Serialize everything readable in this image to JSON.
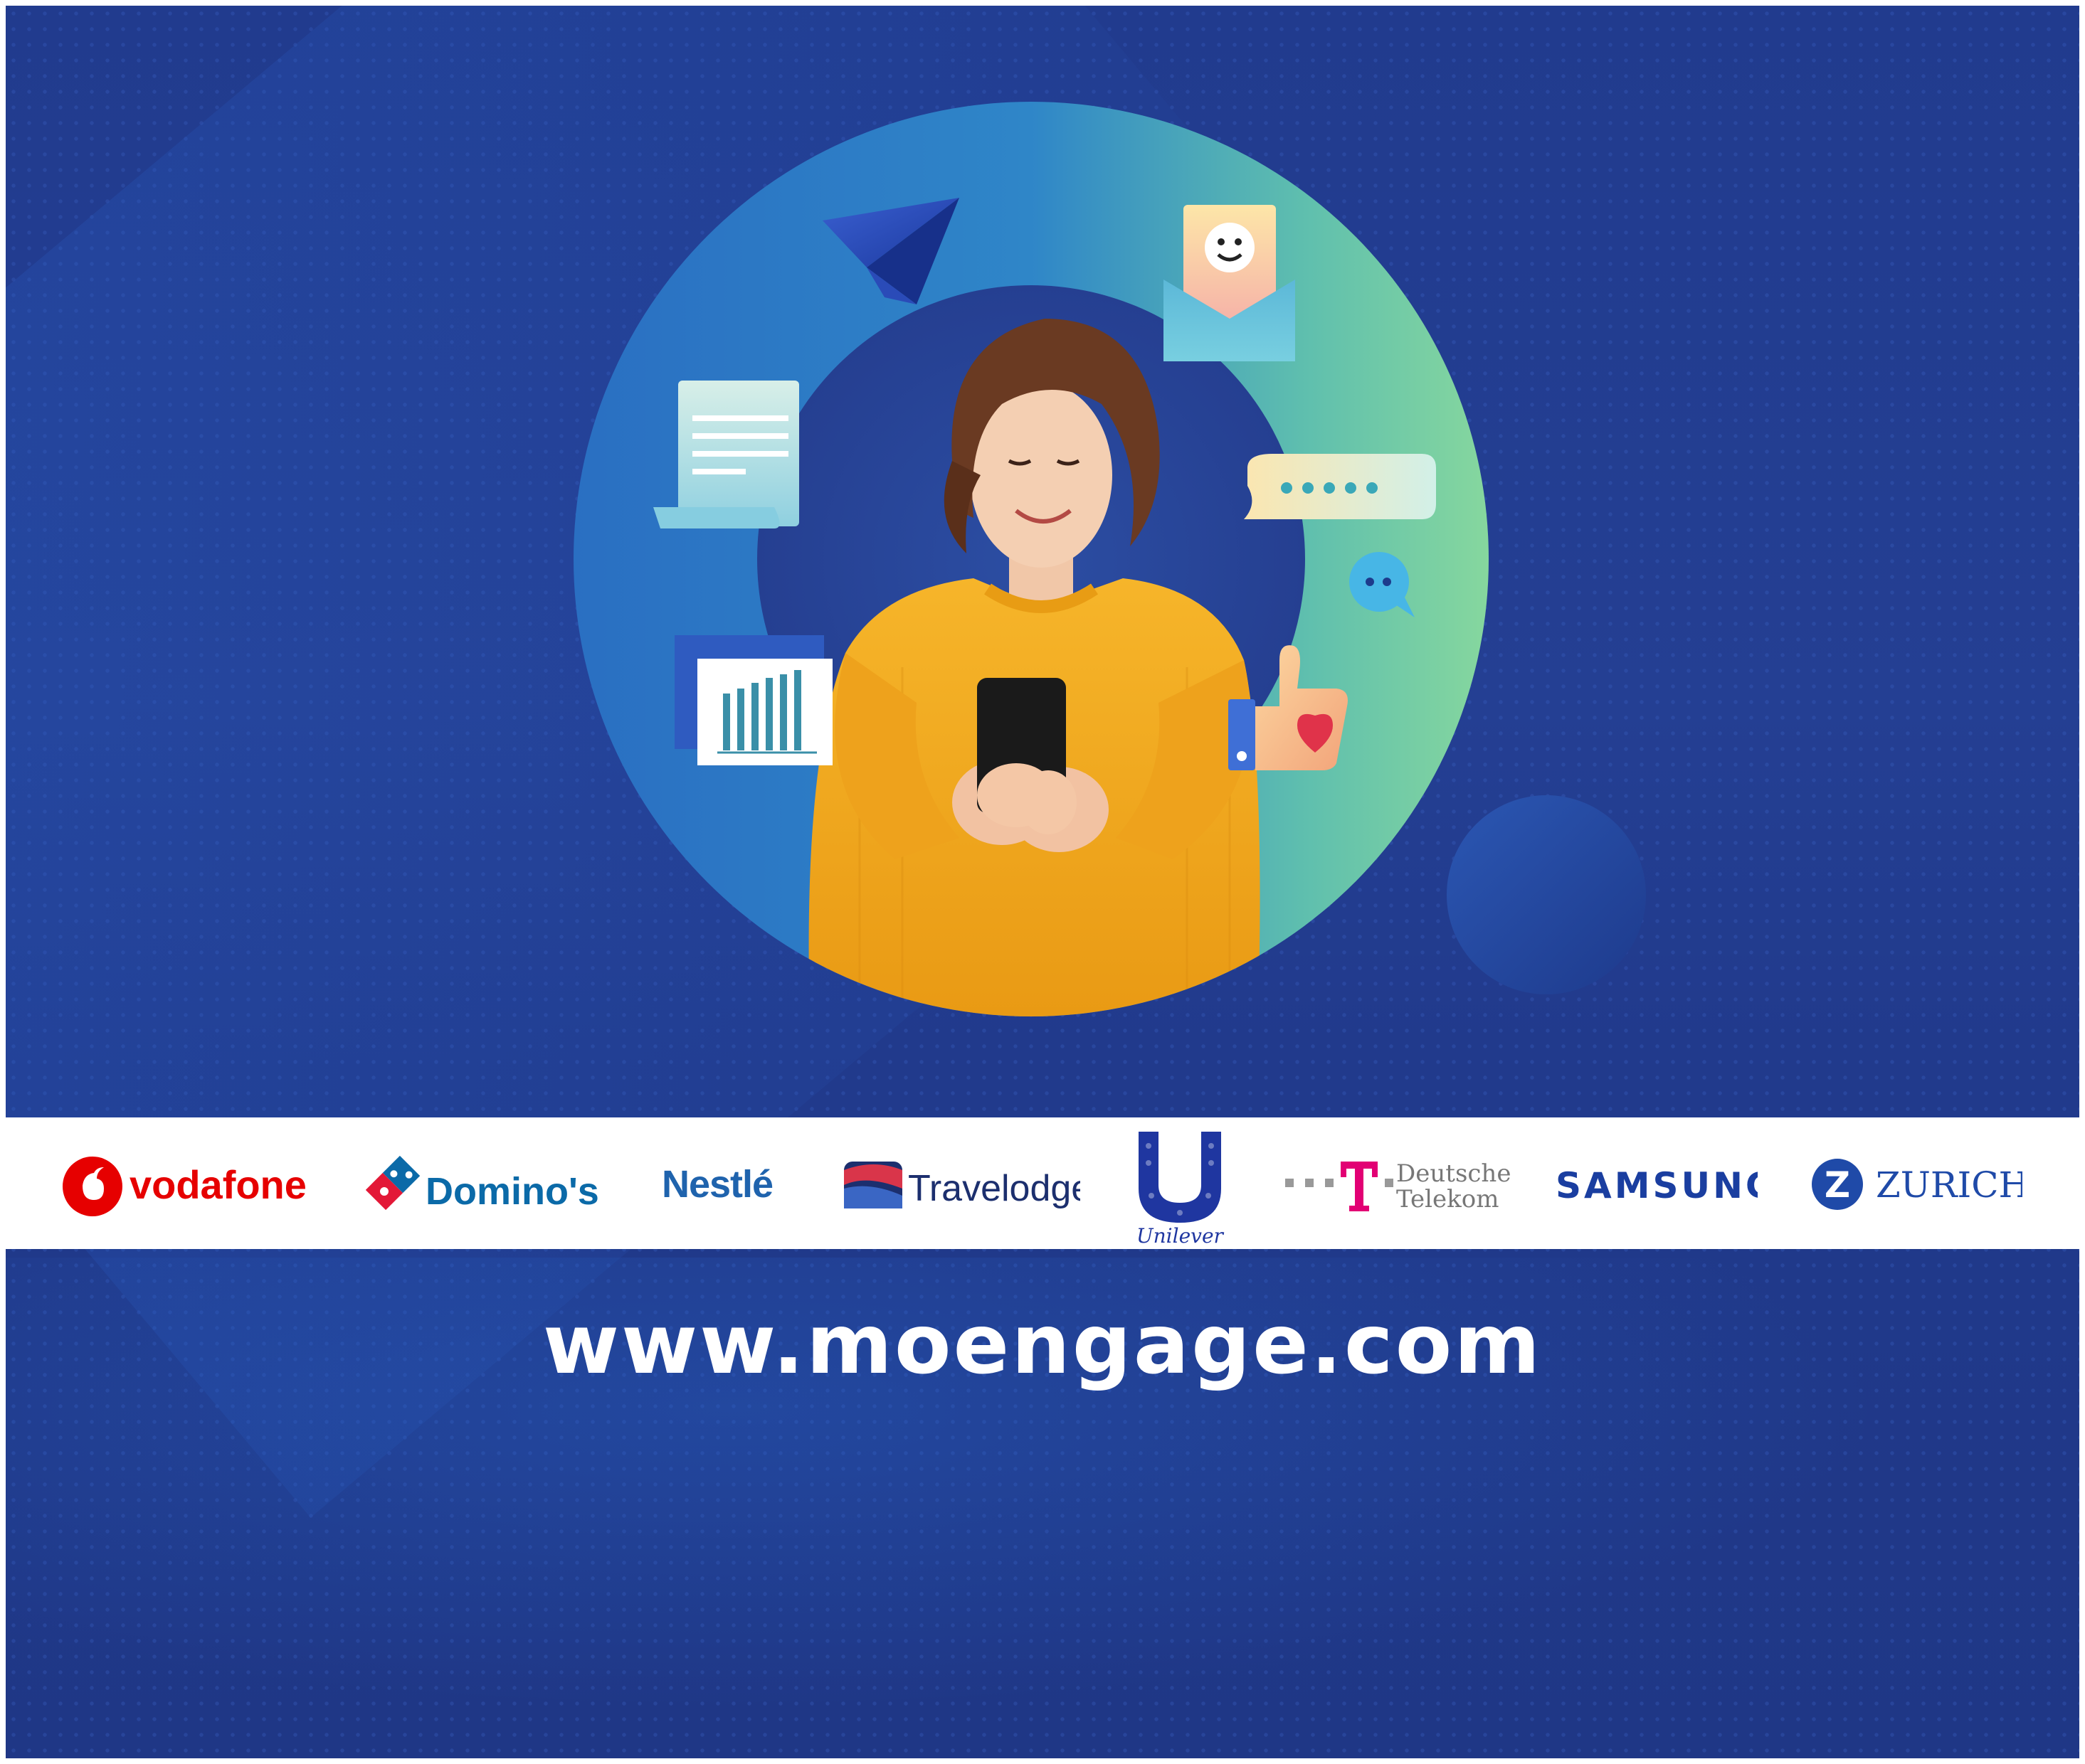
{
  "banner": {
    "url_text": "www.moengage.com"
  },
  "logos": {
    "vodafone": "vodafone",
    "dominos": "Domino's",
    "nestle": "Nestlé",
    "travelodge": "Travelodge",
    "unilever": "Unilever",
    "deutsche_telekom_line1": "Deutsche",
    "deutsche_telekom_line2": "Telekom",
    "samsung": "SAMSUNG",
    "zurich": "ZURICH"
  },
  "colors": {
    "background": "#223c8f",
    "ring_start": "#2a73c4",
    "ring_end": "#7fd6a0",
    "sweater": "#f2a51c",
    "vodafone_red": "#e60000",
    "dominos_blue": "#0b6aa8",
    "nestle_blue": "#1f63ad",
    "travelodge_navy": "#1c2f6e",
    "unilever_blue": "#1f36a0",
    "telekom_magenta": "#e20074",
    "samsung_blue": "#1a3ea0",
    "zurich_blue": "#1f4aa8"
  },
  "icons": [
    "paper-plane-icon",
    "document-icon",
    "bar-chart-icon",
    "smiley-envelope-icon",
    "chat-bubble-icon",
    "small-chat-bubble-icon",
    "thumbs-up-heart-icon"
  ]
}
